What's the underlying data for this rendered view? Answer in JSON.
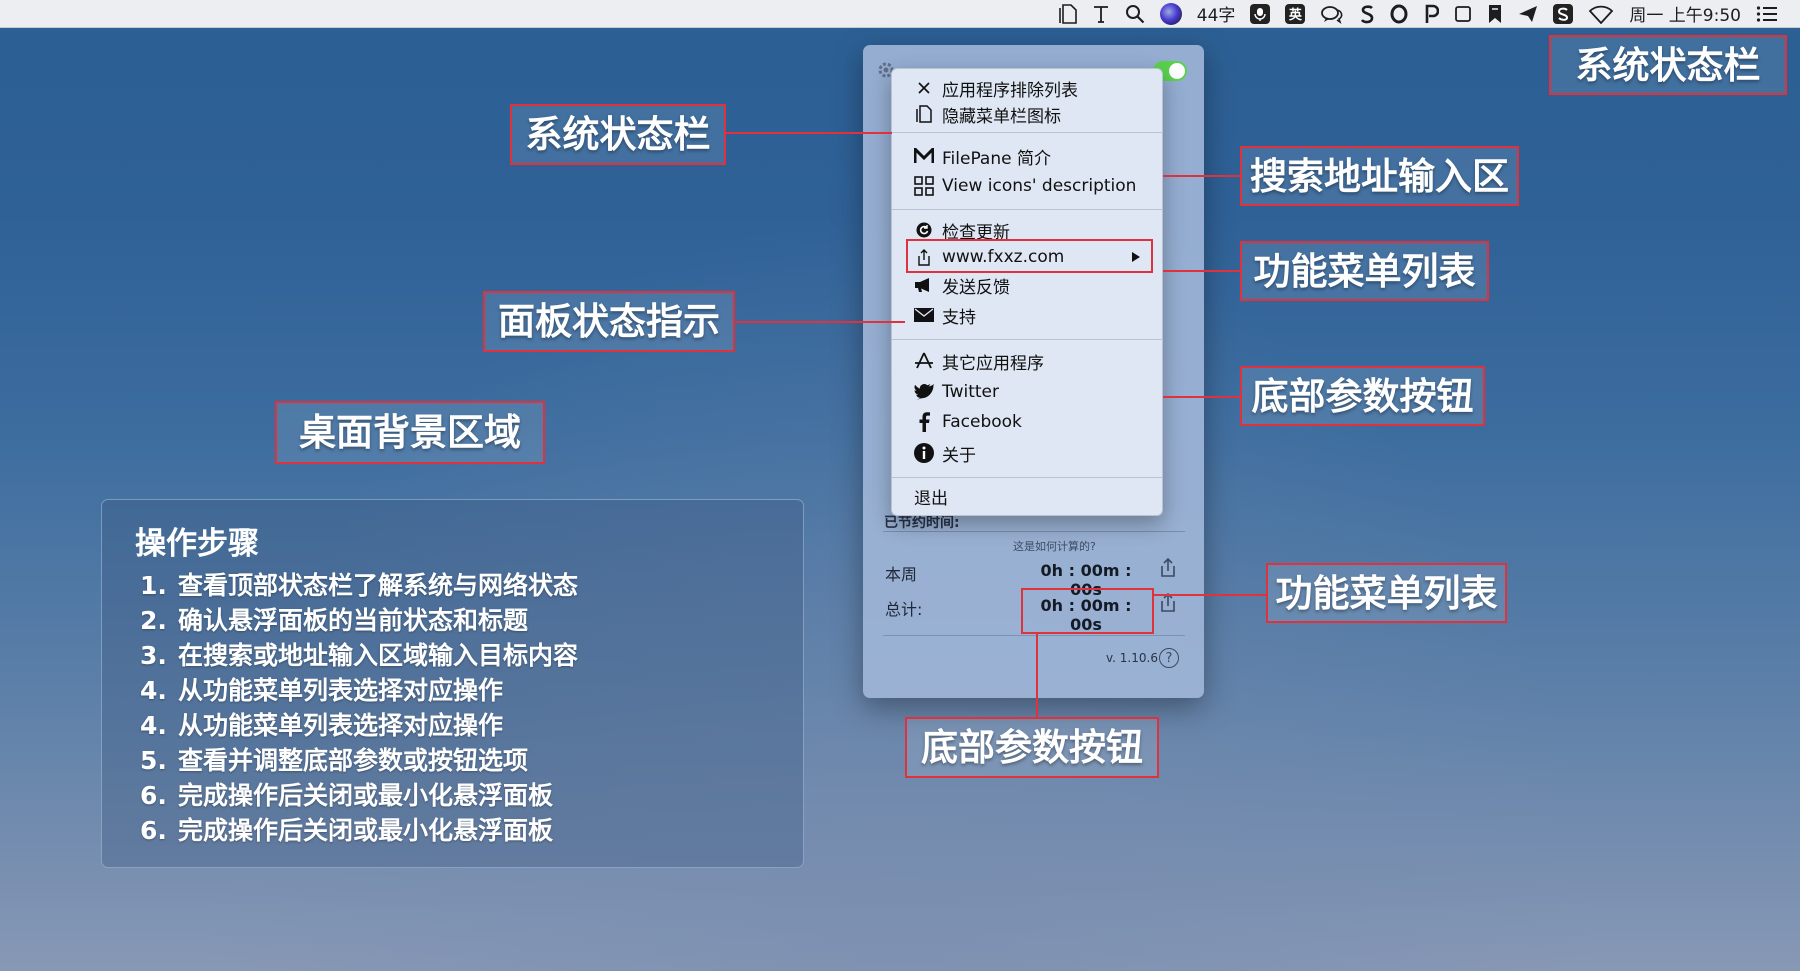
{
  "menubar": {
    "input_indicator": "44字",
    "input_method_1": "英",
    "clock": "周一 上午9:50"
  },
  "labels": {
    "status_bar_top": "系统状态栏",
    "status_bar": "系统状态栏",
    "search_area": "搜索地址输入区",
    "function_menu_1": "功能菜单列表",
    "panel_status": "面板状态指示",
    "bottom_params_1": "底部参数按钮",
    "desktop_bg": "桌面背景区域",
    "function_menu_2": "功能菜单列表",
    "bottom_params_2": "底部参数按钮"
  },
  "menu": {
    "items": [
      {
        "label": "应用程序排除列表",
        "icon": "close-x-icon"
      },
      {
        "label": "隐藏菜单栏图标",
        "icon": "document-icon"
      },
      {
        "label": "FilePane 简介",
        "icon": "m-logo-icon"
      },
      {
        "label": "View icons' description",
        "icon": "grid-icon"
      },
      {
        "label": "检查更新",
        "icon": "refresh-icon"
      },
      {
        "label": "www.fxxz.com",
        "icon": "share-icon"
      },
      {
        "label": "发送反馈",
        "icon": "megaphone-icon"
      },
      {
        "label": "支持",
        "icon": "envelope-icon"
      },
      {
        "label": "其它应用程序",
        "icon": "app-store-icon"
      },
      {
        "label": "Twitter",
        "icon": "twitter-icon"
      },
      {
        "label": "Facebook",
        "icon": "facebook-icon"
      },
      {
        "label": "关于",
        "icon": "info-icon"
      },
      {
        "label": "退出",
        "icon": ""
      }
    ]
  },
  "panel": {
    "saved_time_label": "已节约时间:",
    "saved_time_hint": "这是如何计算的?",
    "week_label": "本周",
    "week_value": "0h : 00m : 00s",
    "total_label": "总计:",
    "total_value": "0h : 00m : 00s",
    "version": "v. 1.10.6",
    "help": "?"
  },
  "steps": {
    "title": "操作步骤",
    "items": [
      {
        "num": "1.",
        "text": "查看顶部状态栏了解系统与网络状态"
      },
      {
        "num": "2.",
        "text": "确认悬浮面板的当前状态和标题"
      },
      {
        "num": "3.",
        "text": "在搜索或地址输入区域输入目标内容"
      },
      {
        "num": "4.",
        "text": "从功能菜单列表选择对应操作"
      },
      {
        "num": "4.",
        "text": "从功能菜单列表选择对应操作"
      },
      {
        "num": "5.",
        "text": "查看并调整底部参数或按钮选项"
      },
      {
        "num": "6.",
        "text": "完成操作后关闭或最小化悬浮面板"
      },
      {
        "num": "6.",
        "text": "完成操作后关闭或最小化悬浮面板"
      }
    ]
  },
  "colors": {
    "annotation_red": "#e0323c",
    "toggle_green": "#5bd14f"
  }
}
